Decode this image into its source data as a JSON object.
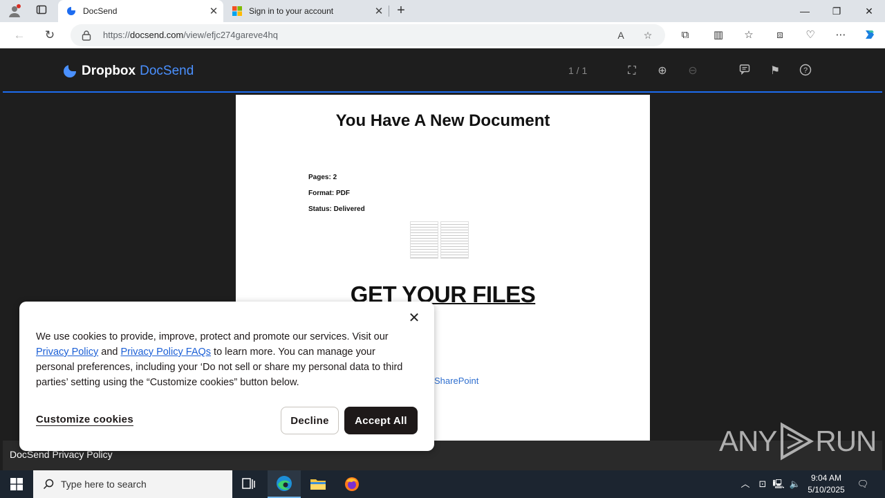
{
  "browser": {
    "tabs": [
      {
        "label": "DocSend",
        "active": true
      },
      {
        "label": "Sign in to your account",
        "active": false
      }
    ],
    "url_prefix": "https://",
    "url_domain": "docsend.com",
    "url_path": "/view/efjc274gareve4hq"
  },
  "viewer": {
    "brand_primary": "Dropbox",
    "brand_secondary": "DocSend",
    "page_count": "1 / 1",
    "footer_link": "DocSend Privacy Policy"
  },
  "document": {
    "title": "You Have A New Document",
    "pages": "Pages: 2",
    "format": "Format: PDF",
    "status": "Status: Delivered",
    "cta": "GET YOUR FILES",
    "link": "SharePoint"
  },
  "cookie_banner": {
    "text_1": "We use cookies to provide, improve, protect and promote our services. Visit our ",
    "link_1": "Privacy Policy",
    "text_2": " and ",
    "link_2": "Privacy Policy FAQs",
    "text_3": " to learn more. You can manage your personal preferences, including your ‘Do not sell or share my personal data to third parties’ setting using the “Customize cookies” button below.",
    "customize": "Customize cookies",
    "decline": "Decline",
    "accept": "Accept All"
  },
  "watermark": {
    "left": "ANY",
    "right": "RUN"
  },
  "taskbar": {
    "search_placeholder": "Type here to search",
    "time": "9:04 AM",
    "date": "5/10/2025"
  },
  "colors": {
    "accent": "#1d6cf0",
    "brand_blue": "#4a90ff",
    "page_bg": "#1e1e1e"
  }
}
